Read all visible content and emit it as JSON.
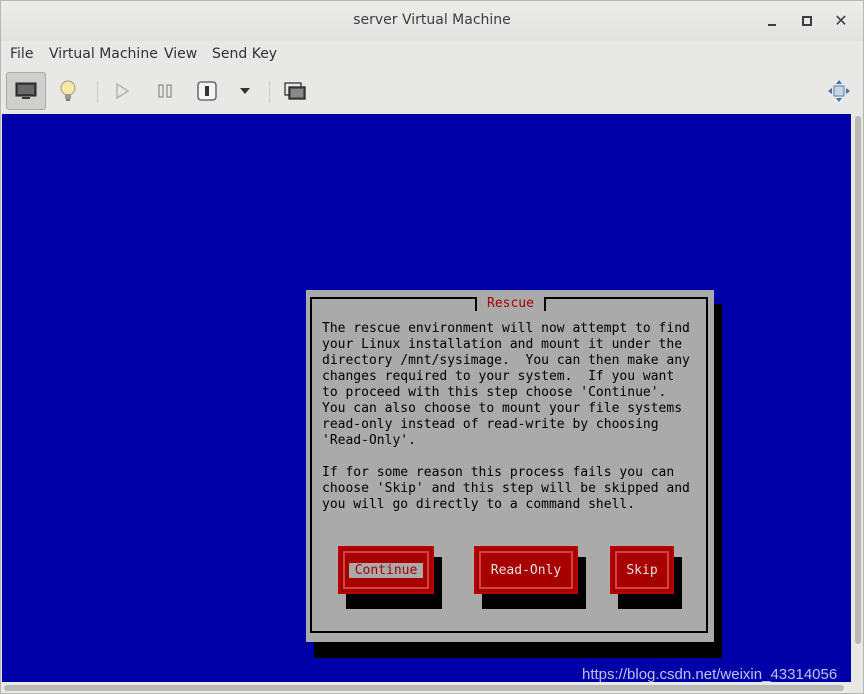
{
  "window": {
    "title": "server Virtual Machine"
  },
  "menu": {
    "file": "File",
    "virtual_machine": "Virtual Machine",
    "view": "View",
    "send_key": "Send Key"
  },
  "dialog": {
    "title": "Rescue",
    "body": "The rescue environment will now attempt to find\nyour Linux installation and mount it under the\ndirectory /mnt/sysimage.  You can then make any\nchanges required to your system.  If you want\nto proceed with this step choose 'Continue'.\nYou can also choose to mount your file systems\nread-only instead of read-write by choosing\n'Read-Only'.\n\nIf for some reason this process fails you can\nchoose 'Skip' and this step will be skipped and\nyou will go directly to a command shell.",
    "buttons": {
      "continue": "Continue",
      "read_only": "Read-Only",
      "skip": "Skip"
    }
  },
  "watermark": "https://blog.csdn.net/weixin_43314056",
  "colors": {
    "console_bg": "#0000a8",
    "dialog_bg": "#aaaaaa",
    "button_red": "#a80000"
  }
}
